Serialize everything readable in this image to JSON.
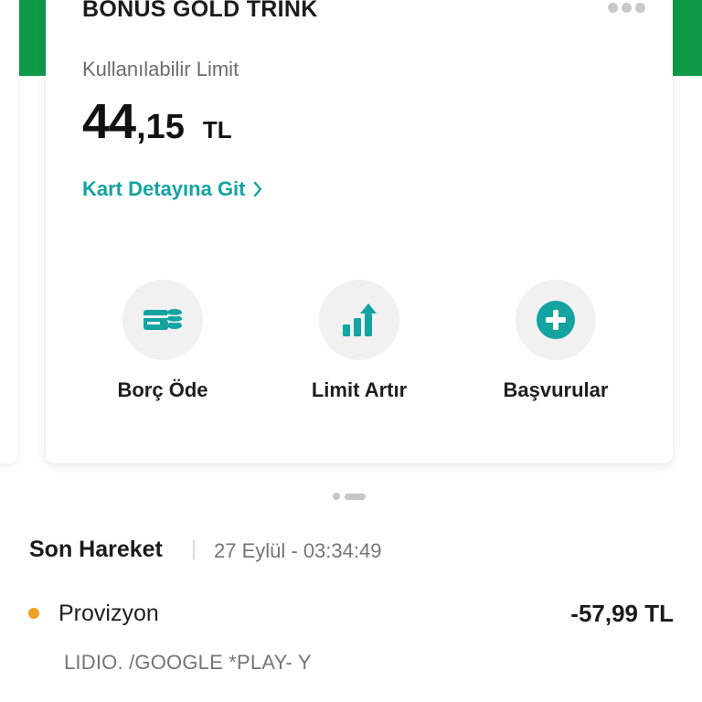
{
  "card": {
    "title": "BONUS GOLD TRINK",
    "more_icon": "more-horizontal-icon",
    "limit_label": "Kullanılabilir Limit",
    "limit_amount_whole": "44",
    "limit_amount_decimal": ",15",
    "limit_currency": "TL",
    "detail_link_label": "Kart Detayına Git",
    "detail_link_icon": "chevron-right-icon",
    "accent_color": "#13a3a0",
    "brand_color": "#0f9a48"
  },
  "actions": [
    {
      "label": "Borç Öde",
      "icon": "card-coins-icon"
    },
    {
      "label": "Limit Artır",
      "icon": "bar-chart-up-icon"
    },
    {
      "label": "Başvurular",
      "icon": "plus-circle-icon"
    }
  ],
  "pager": {
    "active_index": 1,
    "count": 2
  },
  "last_transaction": {
    "title": "Son Hareket",
    "date": "27 Eylül - 03:34:49",
    "type": "Provizyon",
    "amount": "-57,99 TL",
    "description": "LIDIO. /GOOGLE *PLAY- Y",
    "status_color": "#f0a01e"
  }
}
